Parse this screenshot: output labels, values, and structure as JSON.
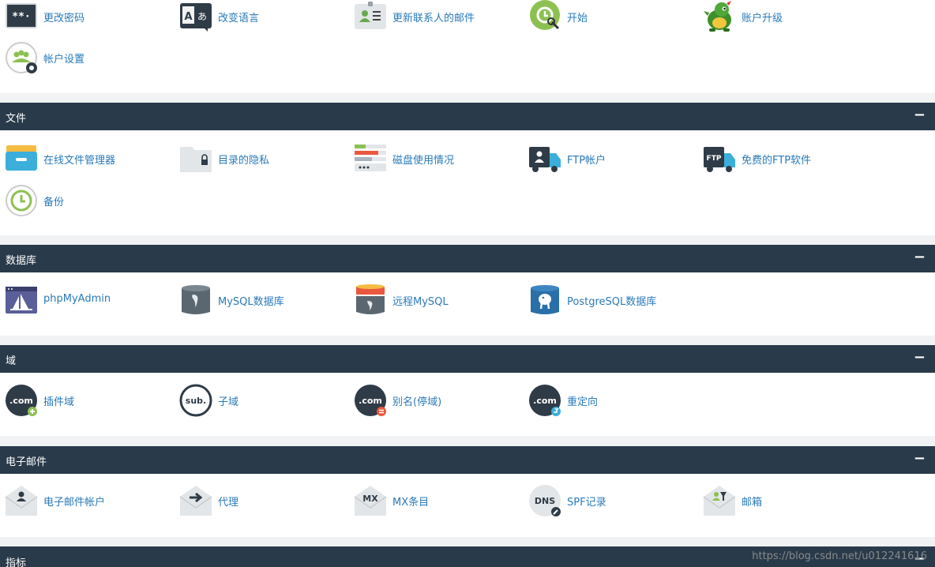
{
  "preferences": {
    "items": [
      {
        "label": "更改密码",
        "icon": "password-icon"
      },
      {
        "label": "改变语言",
        "icon": "language-icon"
      },
      {
        "label": "更新联系人的邮件",
        "icon": "contact-card-icon"
      },
      {
        "label": "开始",
        "icon": "getting-started-icon"
      },
      {
        "label": "账户升级",
        "icon": "dragon-mascot-icon"
      },
      {
        "label": "帐户设置",
        "icon": "account-settings-icon"
      }
    ]
  },
  "sections": [
    {
      "title": "文件",
      "toggle": "−",
      "items": [
        {
          "label": "在线文件管理器",
          "icon": "file-manager-icon"
        },
        {
          "label": "目录的隐私",
          "icon": "directory-privacy-icon"
        },
        {
          "label": "磁盘使用情况",
          "icon": "disk-usage-icon"
        },
        {
          "label": "FTP帐户",
          "icon": "ftp-account-icon"
        },
        {
          "label": "免费的FTP软件",
          "icon": "ftp-software-icon"
        },
        {
          "label": "备份",
          "icon": "backup-icon"
        }
      ]
    },
    {
      "title": "数据库",
      "toggle": "−",
      "items": [
        {
          "label": "phpMyAdmin",
          "icon": "phpmyadmin-icon"
        },
        {
          "label": "MySQL数据库",
          "icon": "mysql-database-icon"
        },
        {
          "label": "远程MySQL",
          "icon": "remote-mysql-icon"
        },
        {
          "label": "PostgreSQL数据库",
          "icon": "postgresql-icon"
        }
      ]
    },
    {
      "title": "域",
      "toggle": "−",
      "items": [
        {
          "label": "插件域",
          "icon": "addon-domain-icon",
          "badge_text": ".com"
        },
        {
          "label": "子域",
          "icon": "subdomain-icon",
          "badge_text": "sub."
        },
        {
          "label": "别名(停域)",
          "icon": "alias-domain-icon",
          "badge_text": ".com"
        },
        {
          "label": "重定向",
          "icon": "redirect-icon",
          "badge_text": ".com"
        }
      ]
    },
    {
      "title": "电子邮件",
      "toggle": "−",
      "items": [
        {
          "label": "电子邮件帐户",
          "icon": "email-account-icon"
        },
        {
          "label": "代理",
          "icon": "forwarder-icon"
        },
        {
          "label": "MX条目",
          "icon": "mx-entry-icon",
          "badge_text": "MX"
        },
        {
          "label": "SPF记录",
          "icon": "spf-record-icon",
          "badge_text": "DNS"
        },
        {
          "label": "邮箱",
          "icon": "mail-filter-icon"
        }
      ]
    },
    {
      "title": "指标",
      "toggle": "−",
      "items": []
    }
  ],
  "watermark": "https://blog.csdn.net/u012241616",
  "colors": {
    "header_bg": "#293a4a",
    "link": "#2a7ab8",
    "page_bg": "#f0f2f3"
  }
}
